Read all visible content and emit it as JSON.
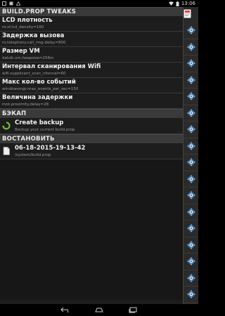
{
  "status_bar": {
    "time": "13:06"
  },
  "sections": [
    {
      "title": "BUILD.PROP TWEAKS",
      "items": [
        {
          "title": "LCD плотность",
          "subtitle": "ro.sf.lcd_density=160"
        },
        {
          "title": "Задержка вызова",
          "subtitle": "ro.telephony.call_ring.delay=800"
        },
        {
          "title": "Размер VM",
          "subtitle": "dalvik.vm.heapsize=256m"
        },
        {
          "title": "Интервал сканирования Wifi",
          "subtitle": "wifi.supplicant_scan_interval=60"
        },
        {
          "title": "Макс кол-во событий",
          "subtitle": "windowsmgr.max_events_per_sec=150"
        },
        {
          "title": "Величина задержки",
          "subtitle": "mot.proximity.delay=28"
        }
      ]
    },
    {
      "title": "БЭКАП",
      "items": [
        {
          "title": "Create backup",
          "subtitle": "Backup your current build.prop",
          "icon": "backup-icon"
        }
      ]
    },
    {
      "title": "ВОСТАНОВИТЬ",
      "items": [
        {
          "title": "06-18-2015-19-13-42",
          "subtitle": "/system/build.prop",
          "icon": "file-icon"
        }
      ]
    }
  ],
  "side_panel": {
    "icon": "app-icon",
    "row_icon": "gear-icon"
  }
}
